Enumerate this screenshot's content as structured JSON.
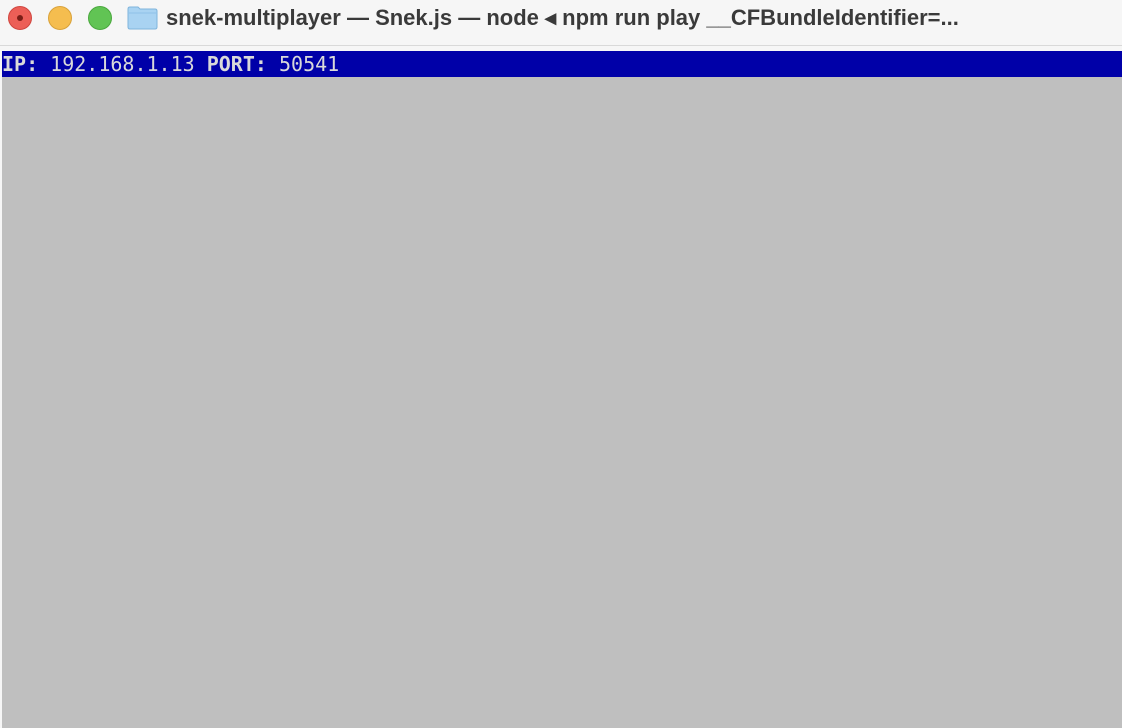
{
  "window": {
    "title": "snek-multiplayer — Snek.js — node ◂ npm run play __CFBundleIdentifier=..."
  },
  "status": {
    "ip_label": "IP:",
    "ip_value": "192.168.1.13",
    "port_label": "PORT:",
    "port_value": "50541"
  },
  "colors": {
    "status_bar_bg": "#0000a8",
    "status_text": "#d9d9d9",
    "game_bg": "#bfbfbf"
  },
  "icons": {
    "folder": "folder-icon",
    "close": "close-icon",
    "minimize": "minimize-icon",
    "zoom": "zoom-icon"
  }
}
